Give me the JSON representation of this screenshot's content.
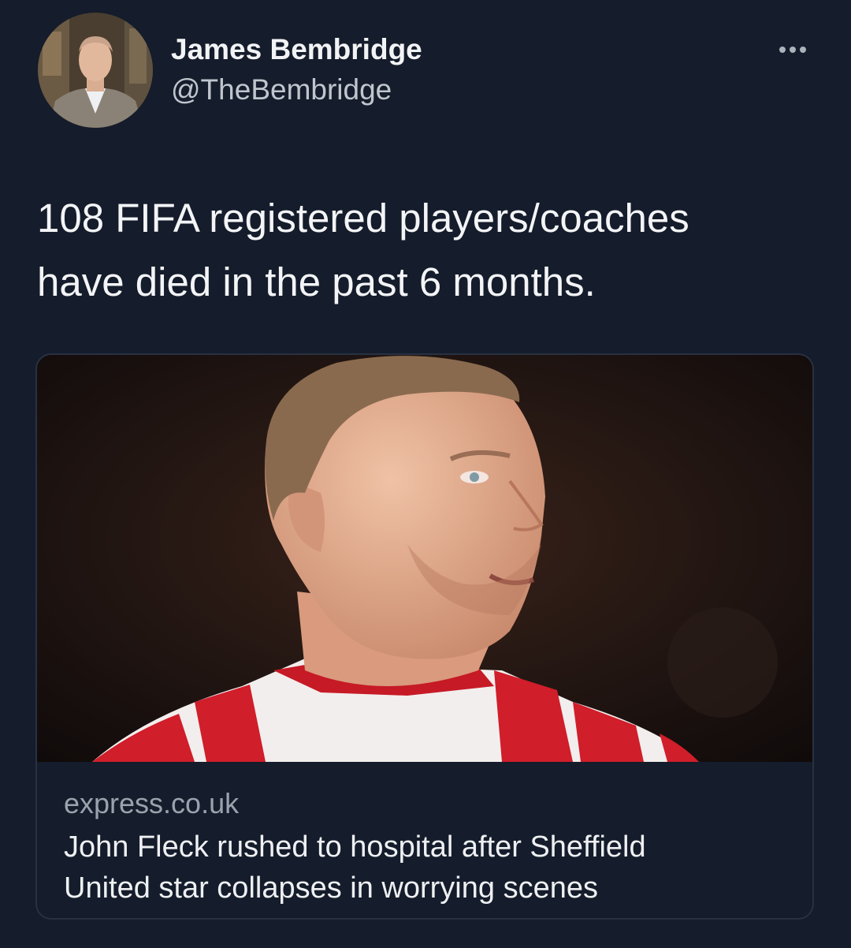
{
  "author": {
    "name": "James Bembridge",
    "handle": "@TheBembridge",
    "avatar_icon": "profile-photo"
  },
  "more_icon": "ellipsis-icon",
  "tweet": {
    "text_line1": "108 FIFA registered players/coaches",
    "text_line2": "have died in the past 6 months."
  },
  "link_card": {
    "domain": "express.co.uk",
    "headline_line1": "John Fleck rushed to hospital after Sheffield",
    "headline_line2": "United star collapses in worrying scenes",
    "image": "football-player-photo"
  },
  "colors": {
    "background": "#151c2b",
    "text": "#f3f4f6",
    "secondary_text": "#9aa3ad",
    "card_border": "#283142",
    "kit_red": "#d01e2a"
  }
}
